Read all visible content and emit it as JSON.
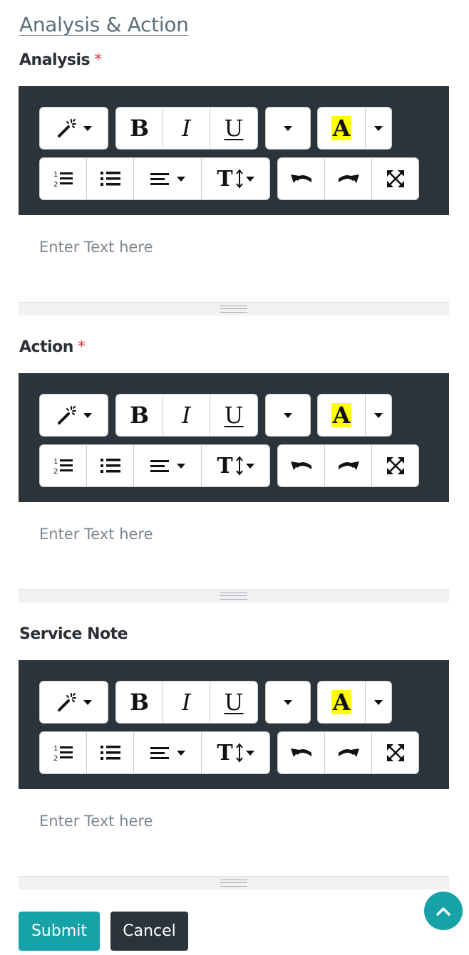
{
  "section_title": "Analysis & Action",
  "required_mark": "*",
  "toolbar": {
    "bold_label": "B",
    "italic_label": "I",
    "underline_label": "U",
    "highlight_label": "A",
    "text_size_label": "T",
    "highlight_color": "#ffff00",
    "background_color": "#2c343b"
  },
  "editors": [
    {
      "label": "Analysis",
      "required": true,
      "placeholder": "Enter Text here"
    },
    {
      "label": "Action",
      "required": true,
      "placeholder": "Enter Text here"
    },
    {
      "label": "Service Note",
      "required": false,
      "placeholder": "Enter Text here"
    }
  ],
  "buttons": {
    "submit": "Submit",
    "cancel": "Cancel",
    "submit_color": "#17a2a9",
    "cancel_color": "#2c343b"
  },
  "icons": [
    "magic-wand-icon",
    "ordered-list-icon",
    "unordered-list-icon",
    "align-icon",
    "undo-icon",
    "redo-icon",
    "fullscreen-icon",
    "chevron-up-icon"
  ]
}
